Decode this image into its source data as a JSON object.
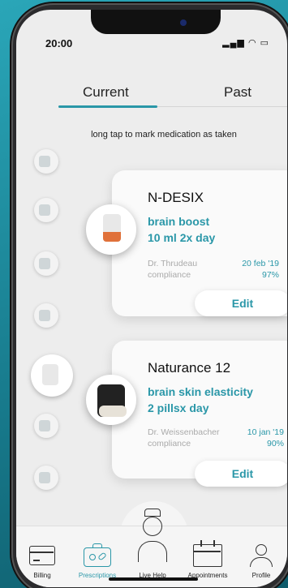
{
  "status_bar": {
    "time": "20:00",
    "icons": "▂▄▆ ◠ ▭"
  },
  "tabs": [
    {
      "label": "Current"
    },
    {
      "label": "Past"
    }
  ],
  "hint": "long tap to mark medication as taken",
  "medications": [
    {
      "name": "N-DESIX",
      "purpose": "brain boost",
      "dosage": "10 ml 2x day",
      "doctor": "Dr. Thrudeau",
      "date": "20 feb '19",
      "compliance_label": "compliance",
      "compliance_value": "97%",
      "edit_label": "Edit"
    },
    {
      "name": "Naturance 12",
      "purpose": "brain skin elasticity",
      "dosage": "2 pillsx day",
      "doctor": "Dr. Weissenbacher",
      "date": "10 jan '19",
      "compliance_label": "compliance",
      "compliance_value": "90%",
      "edit_label": "Edit"
    }
  ],
  "bottom_nav": [
    {
      "label": "Billing",
      "icon": "credit-card-icon",
      "active": false
    },
    {
      "label": "Prescriptions",
      "icon": "first-aid-kit-icon",
      "active": true
    },
    {
      "label": "Live Help",
      "icon": "nurse-icon",
      "active": false
    },
    {
      "label": "Appointments",
      "icon": "calendar-icon",
      "active": false
    },
    {
      "label": "Profile",
      "icon": "user-icon",
      "active": false
    }
  ],
  "colors": {
    "accent": "#2a97a8",
    "background": "#ededed",
    "card": "#fafafa"
  }
}
